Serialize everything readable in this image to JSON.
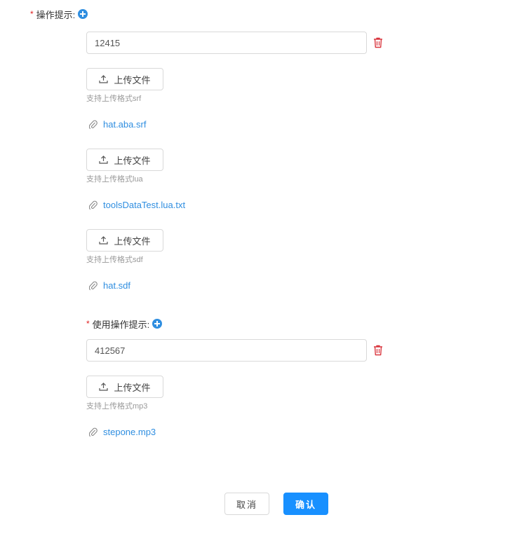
{
  "section1": {
    "label": "操作提示:",
    "required_mark": "*",
    "input_value": "12415",
    "uploads": [
      {
        "button_label": "上传文件",
        "hint": "支持上传格式srf",
        "file_name": "hat.aba.srf"
      },
      {
        "button_label": "上传文件",
        "hint": "支持上传格式lua",
        "file_name": "toolsDataTest.lua.txt"
      },
      {
        "button_label": "上传文件",
        "hint": "支持上传格式sdf",
        "file_name": "hat.sdf"
      }
    ]
  },
  "section2": {
    "label": "使用操作提示:",
    "required_mark": "*",
    "input_value": "412567",
    "uploads": [
      {
        "button_label": "上传文件",
        "hint": "支持上传格式mp3",
        "file_name": "stepone.mp3"
      }
    ]
  },
  "footer": {
    "cancel_label": "取消",
    "confirm_label": "确认"
  },
  "colors": {
    "accent": "#1890ff",
    "link": "#2f8ee0",
    "danger": "#e02020",
    "hint": "#999999"
  },
  "icons": {
    "add": "plus-circle-icon",
    "delete": "trash-icon",
    "upload": "upload-icon",
    "attachment": "paperclip-icon"
  }
}
